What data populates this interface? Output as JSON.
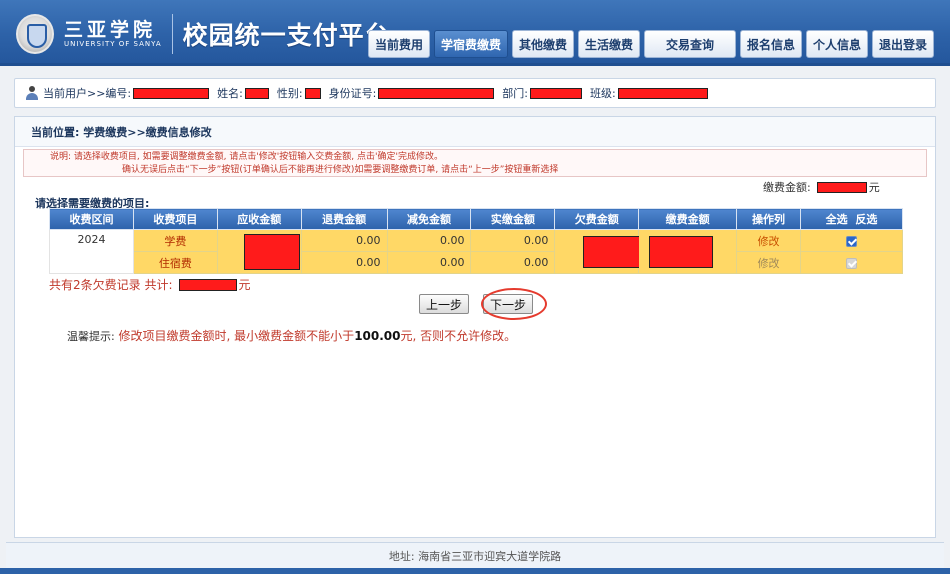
{
  "header": {
    "logo_cn": "三亚学院",
    "logo_en": "UNIVERSITY OF SANYA",
    "platform_title": "校园统一支付平台",
    "nav": [
      {
        "label": "当前费用",
        "active": false
      },
      {
        "label": "学宿费缴费",
        "active": true
      },
      {
        "label": "其他缴费",
        "active": false
      },
      {
        "label": "生活缴费",
        "active": false
      },
      {
        "label": "交易查询",
        "active": false
      },
      {
        "label": "报名信息",
        "active": false
      },
      {
        "label": "个人信息",
        "active": false
      },
      {
        "label": "退出登录",
        "active": false
      }
    ]
  },
  "userbar": {
    "current_user": "当前用户>>编号:",
    "name_label": "姓名:",
    "gender_label": "性别:",
    "idcard_label": "身份证号:",
    "dept_label": "部门:",
    "class_label": "班级:"
  },
  "main": {
    "breadcrumb": "当前位置: 学费缴费>>缴费信息修改",
    "notice_line1": "说明: 请选择收费项目, 如需要调整缴费金额, 请点击'修改'按钮输入交费金额, 点击'确定'完成修改。",
    "notice_line2": "确认无误后点击“下一步”按钮(订单确认后不能再进行修改)如需要调整缴费订单, 请点击“上一步”按钮重新选择",
    "amount_label": "缴费金额:",
    "amount_unit": "元",
    "select_label": "请选择需要缴费的项目:",
    "table": {
      "headers": [
        "收费区间",
        "收费项目",
        "应收金额",
        "退费金额",
        "减免金额",
        "实缴金额",
        "欠费金额",
        "缴费金额",
        "操作列",
        "全选",
        "反选"
      ],
      "period": "2024",
      "rows": [
        {
          "item": "学费",
          "refund": "0.00",
          "reduce": "0.00",
          "paid": "0.00",
          "op": "修改",
          "checked": true
        },
        {
          "item": "住宿费",
          "refund": "0.00",
          "reduce": "0.00",
          "paid": "0.00",
          "op": "修改",
          "checked": true
        }
      ]
    },
    "summary_text": "共有2条欠费记录 共计:",
    "summary_unit": "元",
    "prev_button": "上一步",
    "next_button": "下一步",
    "tip_label": "温馨提示:",
    "tip_text_before": "修改项目缴费金额时, 最小缴费金额不能小于",
    "tip_amount": "100.00",
    "tip_text_after": "元, 否则不允许修改。"
  },
  "footer": {
    "address": "地址: 海南省三亚市迎宾大道学院路"
  }
}
